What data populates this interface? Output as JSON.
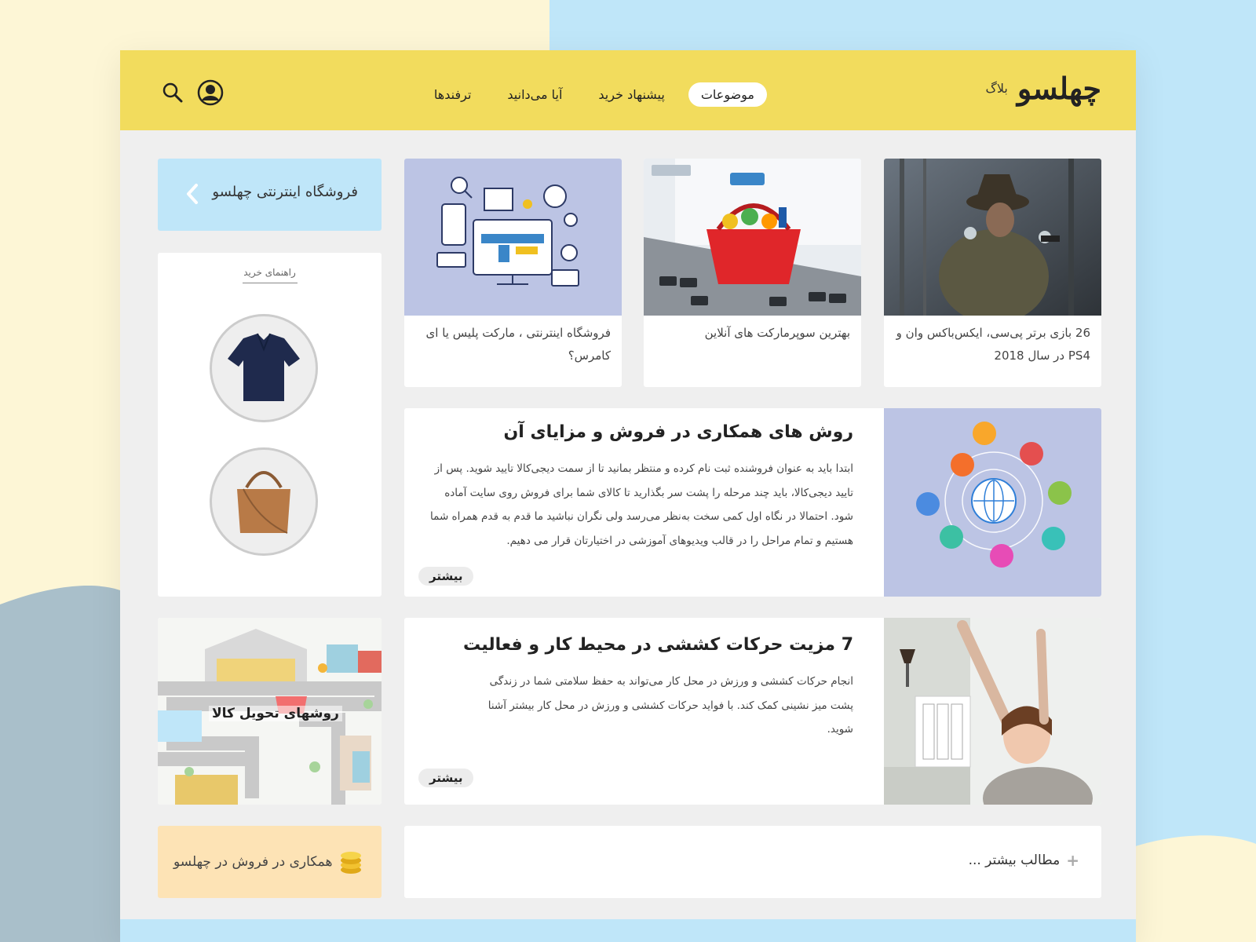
{
  "colors": {
    "header": "#f2dc5d",
    "accent_blue": "#bfe6f9",
    "peach": "#fde3b5",
    "sky": "#bfe6f9"
  },
  "header": {
    "logo_mark": "چهلسو",
    "logo_sub": "بلاگ",
    "nav": [
      {
        "label": "موضوعات",
        "active": true
      },
      {
        "label": "پیشنهاد خرید",
        "active": false
      },
      {
        "label": "آیا می‌دانید",
        "active": false
      },
      {
        "label": "ترفندها",
        "active": false
      }
    ],
    "icons": [
      "search-icon",
      "user-icon"
    ]
  },
  "cards": [
    {
      "title": "26 بازی برتر پی‌سی، ایکس‌باکس وان و PS4 در سال 2018",
      "image": "cowboy-photo"
    },
    {
      "title": "بهترین سوپرمارکت های آنلاین",
      "image": "shopping-basket-photo"
    },
    {
      "title": "فروشگاه اینترنتی ، مارکت پلیس یا ای کامرس؟",
      "image": "ecommerce-illustration"
    }
  ],
  "features": [
    {
      "title": "روش های همکاری در فروش و  مزایای آن",
      "body": "ابتدا باید به عنوان فروشنده ثبت نام کرده و منتظر بمانید تا از سمت دیجی‌کالا تایید شوید. پس از تایید دیجی‌کالا، باید چند مرحله را پشت سر بگذارید تا کالای شما برای فروش روی سایت آماده شود. احتمالا در نگاه اول کمی سخت به‌نظر می‌رسد ولی نگران نباشید ما قدم به قدم همراه شما هستیم و تمام مراحل را در قالب ویدیوهای آموزشی در اختیارتان قرار می دهیم.",
      "more": "بیشتر"
    },
    {
      "title": "7 مزیت حرکات کششی در محیط کار و فعالیت",
      "body": "انجام حرکات کششی و ورزش در محل کار می‌تواند به حفظ سلامتی شما در زندگی پشت میز نشینی کمک کند. با فواید حرکات کششی و ورزش در محل کار بیشتر آشنا شوید.",
      "more": "بیشتر"
    }
  ],
  "more_posts": "مطالب بیشتر ...",
  "sidebar": {
    "store_link": "فروشگاه اینترنتی چهلسو",
    "guide_label": "راهنمای خرید",
    "guide_items": [
      "polo-shirt",
      "leather-bag"
    ],
    "delivery_label": "روشهای تحویل کالا",
    "affiliate_label": "همکاری در فروش در چهلسو"
  }
}
